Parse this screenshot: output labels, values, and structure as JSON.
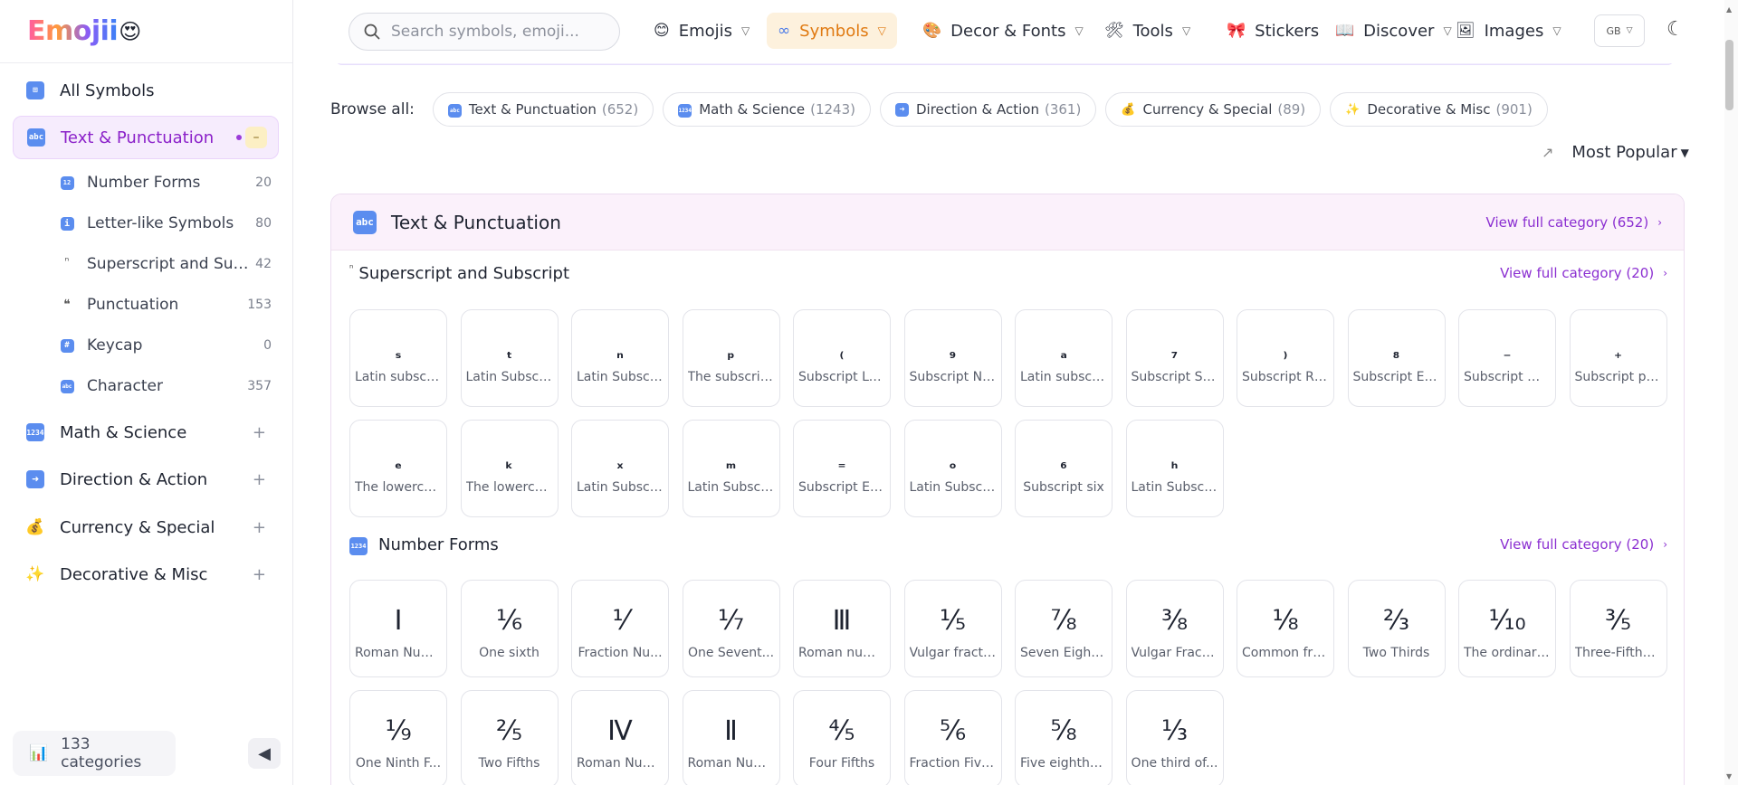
{
  "logo": {
    "text": "Emojii",
    "face": "😍"
  },
  "sidebar": {
    "categories": [
      {
        "label": "All Symbols",
        "icon": "grid-icon"
      },
      {
        "label": "Text & Punctuation",
        "icon": "abc-icon"
      },
      {
        "label": "Math & Science",
        "icon": "numbers-icon"
      },
      {
        "label": "Direction & Action",
        "icon": "arrow-right-icon"
      },
      {
        "label": "Currency & Special",
        "icon": "money-bag-icon"
      },
      {
        "label": "Decorative & Misc",
        "icon": "sparkles-icon"
      }
    ],
    "subcategories": [
      {
        "label": "Number Forms",
        "count": "20"
      },
      {
        "label": "Letter-like Symbols",
        "count": "80"
      },
      {
        "label": "Superscript and Subscript",
        "count": "42"
      },
      {
        "label": "Punctuation",
        "count": "153"
      },
      {
        "label": "Keycap",
        "count": "0"
      },
      {
        "label": "Character",
        "count": "357"
      }
    ],
    "collapse_symbol": "–",
    "plus_symbol": "+",
    "footer_label": "133 categories"
  },
  "nav": {
    "search_placeholder": "Search symbols, emoji...",
    "items": [
      "Emojis",
      "Symbols",
      "Decor & Fonts",
      "Tools",
      "Stickers",
      "Discover",
      "Images"
    ],
    "lang": "GB"
  },
  "browse": {
    "label": "Browse all:",
    "chips": [
      {
        "label": "Text & Punctuation",
        "count": "(652)"
      },
      {
        "label": "Math & Science",
        "count": "(1243)"
      },
      {
        "label": "Direction & Action",
        "count": "(361)"
      },
      {
        "label": "Currency & Special",
        "count": "(89)"
      },
      {
        "label": "Decorative & Misc",
        "count": "(901)"
      }
    ]
  },
  "sort": {
    "label": "Most Popular"
  },
  "panel": {
    "title": "Text & Punctuation",
    "view_all": "View full category (652)",
    "sections": [
      {
        "title": "Superscript and Subscript",
        "view_all": "View full category (20)",
        "tiles": [
          {
            "sym": "ₛ",
            "name": "Latin subscri..."
          },
          {
            "sym": "ₜ",
            "name": "Latin Subscri..."
          },
          {
            "sym": "ₙ",
            "name": "Latin Subscri..."
          },
          {
            "sym": "ₚ",
            "name": "The subscrip..."
          },
          {
            "sym": "₍",
            "name": "Subscript Le..."
          },
          {
            "sym": "₉",
            "name": "Subscript Ni..."
          },
          {
            "sym": "ₐ",
            "name": "Latin subscri..."
          },
          {
            "sym": "₇",
            "name": "Subscript Se..."
          },
          {
            "sym": "₎",
            "name": "Subscript Ri..."
          },
          {
            "sym": "₈",
            "name": "Subscript Ei..."
          },
          {
            "sym": "₋",
            "name": "Subscript Mi..."
          },
          {
            "sym": "₊",
            "name": "Subscript pl..."
          },
          {
            "sym": "ₑ",
            "name": "The lowerca..."
          },
          {
            "sym": "ₖ",
            "name": "The lowerca..."
          },
          {
            "sym": "ₓ",
            "name": "Latin Subscri..."
          },
          {
            "sym": "ₘ",
            "name": "Latin Subscri..."
          },
          {
            "sym": "₌",
            "name": "Subscript Eq..."
          },
          {
            "sym": "ₒ",
            "name": "Latin Subscri..."
          },
          {
            "sym": "₆",
            "name": "Subscript six"
          },
          {
            "sym": "ₕ",
            "name": "Latin Subscri..."
          }
        ]
      },
      {
        "title": "Number Forms",
        "view_all": "View full category (20)",
        "tiles": [
          {
            "sym": "Ⅰ",
            "name": "Roman Num..."
          },
          {
            "sym": "⅙",
            "name": "One sixth"
          },
          {
            "sym": "⅟",
            "name": "Fraction Nu..."
          },
          {
            "sym": "⅐",
            "name": "One Sevent..."
          },
          {
            "sym": "Ⅲ",
            "name": "Roman num..."
          },
          {
            "sym": "⅕",
            "name": "Vulgar fracti..."
          },
          {
            "sym": "⅞",
            "name": "Seven Eighths"
          },
          {
            "sym": "⅜",
            "name": "Vulgar Fracti..."
          },
          {
            "sym": "⅛",
            "name": "Common fra..."
          },
          {
            "sym": "⅔",
            "name": "Two Thirds"
          },
          {
            "sym": "⅒",
            "name": "The ordinary..."
          },
          {
            "sym": "⅗",
            "name": "Three-Fifths ..."
          },
          {
            "sym": "⅑",
            "name": "One Ninth F..."
          },
          {
            "sym": "⅖",
            "name": "Two Fifths"
          },
          {
            "sym": "Ⅳ",
            "name": "Roman Num..."
          },
          {
            "sym": "Ⅱ",
            "name": "Roman Num..."
          },
          {
            "sym": "⅘",
            "name": "Four Fifths"
          },
          {
            "sym": "⅚",
            "name": "Fraction Five..."
          },
          {
            "sym": "⅝",
            "name": "Five eighths ..."
          },
          {
            "sym": "⅓",
            "name": "One third of..."
          }
        ]
      }
    ]
  },
  "colors": {
    "accent": "#8b21c9",
    "active_nav": "#e07a12",
    "panel_head": "#fbf1fb"
  }
}
